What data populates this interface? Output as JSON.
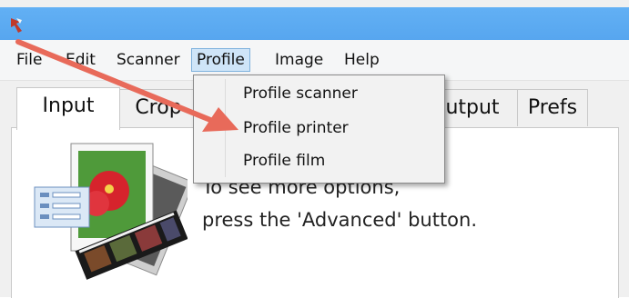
{
  "menubar": {
    "items": [
      {
        "label": "File"
      },
      {
        "label": "Edit"
      },
      {
        "label": "Scanner"
      },
      {
        "label": "Profile"
      },
      {
        "label": "Image"
      },
      {
        "label": "Help"
      }
    ]
  },
  "tabs": [
    {
      "label": "Input"
    },
    {
      "label": "Crop"
    },
    {
      "label": "utput"
    },
    {
      "label": "Prefs"
    }
  ],
  "dropdown": {
    "items": [
      {
        "label": "Profile scanner"
      },
      {
        "label": "Profile printer"
      },
      {
        "label": "Profile film"
      }
    ]
  },
  "panel": {
    "line1": "To see more options,",
    "line2": "press the 'Advanced' button."
  },
  "colors": {
    "titlebar": "#5eacf2",
    "arrow": "#e86a5a",
    "menu_highlight": "#cfe5f8"
  },
  "icons": [
    "app-icon",
    "photo-film-icon",
    "annotation-arrow"
  ]
}
